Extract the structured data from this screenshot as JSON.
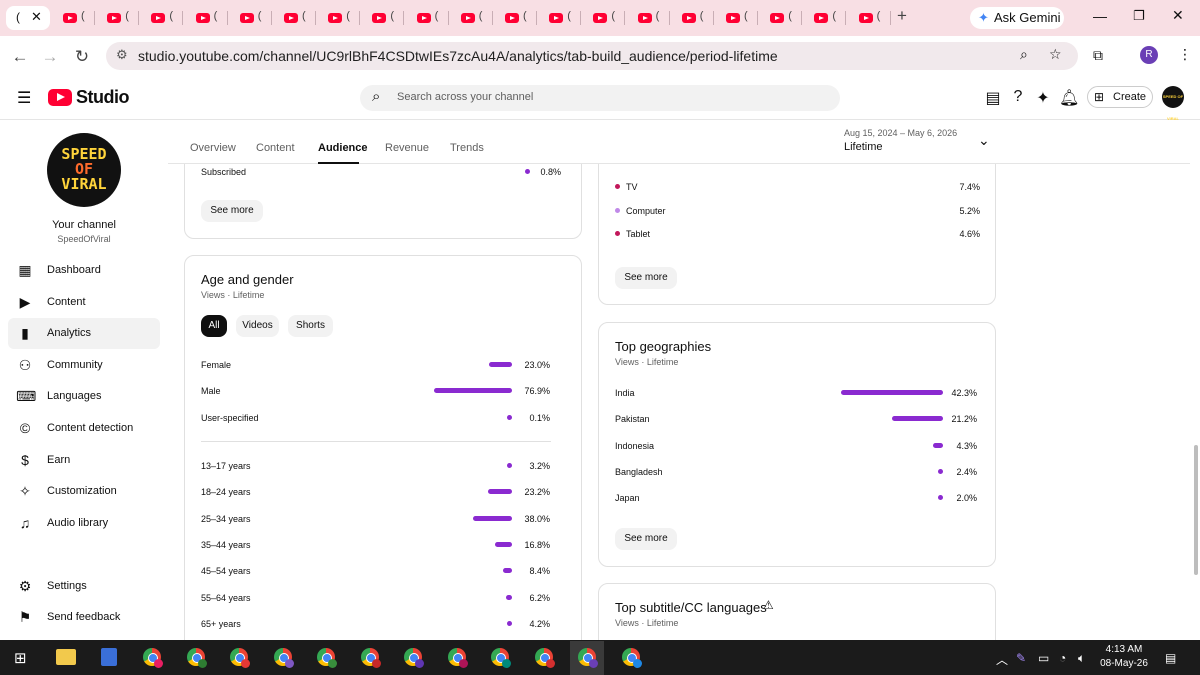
{
  "browser": {
    "ask_gemini": "Ask Gemini",
    "url": "studio.youtube.com/channel/UC9rlBhF4CSDtwIEs7zcAu4A/analytics/tab-build_audience/period-lifetime",
    "new_tab_glyph": "+",
    "profile_initial": "R"
  },
  "studio": {
    "logo_text": "Studio",
    "search_placeholder": "Search across your channel",
    "create_label": "Create",
    "avatar_text": "SPEED OF VIRAL"
  },
  "sidebar": {
    "avatar_lines": [
      "SPEED",
      "OF",
      "VIRAL"
    ],
    "your_channel": "Your channel",
    "handle": "SpeedOfViral",
    "items": [
      {
        "label": "Dashboard",
        "icon": "dashboard-icon"
      },
      {
        "label": "Content",
        "icon": "content-icon"
      },
      {
        "label": "Analytics",
        "icon": "analytics-icon",
        "active": true
      },
      {
        "label": "Community",
        "icon": "community-icon"
      },
      {
        "label": "Languages",
        "icon": "languages-icon"
      },
      {
        "label": "Content detection",
        "icon": "copyright-icon"
      },
      {
        "label": "Earn",
        "icon": "dollar-icon"
      },
      {
        "label": "Customization",
        "icon": "magic-wand-icon"
      },
      {
        "label": "Audio library",
        "icon": "audio-library-icon"
      }
    ],
    "settings": "Settings",
    "feedback": "Send feedback"
  },
  "analytics_tabs": {
    "items": [
      "Overview",
      "Content",
      "Audience",
      "Revenue",
      "Trends"
    ],
    "active": "Audience",
    "period_range": "Aug 15, 2024 – May 6, 2026",
    "period_value": "Lifetime"
  },
  "subscription_card": {
    "row_label": "Subscribed",
    "row_pct": "0.8%",
    "see_more": "See more"
  },
  "age_gender": {
    "title": "Age and gender",
    "subtitle": "Views · Lifetime",
    "filters": [
      "All",
      "Videos",
      "Shorts"
    ],
    "active_filter": "All",
    "gender": [
      {
        "label": "Female",
        "pct": "23.0%",
        "value": 23.0
      },
      {
        "label": "Male",
        "pct": "76.9%",
        "value": 76.9
      },
      {
        "label": "User-specified",
        "pct": "0.1%",
        "value": 0.1
      }
    ],
    "ages": [
      {
        "label": "13–17 years",
        "pct": "3.2%",
        "value": 3.2
      },
      {
        "label": "18–24 years",
        "pct": "23.2%",
        "value": 23.2
      },
      {
        "label": "25–34 years",
        "pct": "38.0%",
        "value": 38.0
      },
      {
        "label": "35–44 years",
        "pct": "16.8%",
        "value": 16.8
      },
      {
        "label": "45–54 years",
        "pct": "8.4%",
        "value": 8.4
      },
      {
        "label": "55–64 years",
        "pct": "6.2%",
        "value": 6.2
      },
      {
        "label": "65+ years",
        "pct": "4.2%",
        "value": 4.2
      }
    ]
  },
  "device_card": {
    "rows": [
      {
        "label": "TV",
        "pct": "7.4%"
      },
      {
        "label": "Computer",
        "pct": "5.2%"
      },
      {
        "label": "Tablet",
        "pct": "4.6%"
      }
    ],
    "see_more": "See more"
  },
  "geographies": {
    "title": "Top geographies",
    "subtitle": "Views · Lifetime",
    "rows": [
      {
        "label": "India",
        "pct": "42.3%",
        "value": 42.3
      },
      {
        "label": "Pakistan",
        "pct": "21.2%",
        "value": 21.2
      },
      {
        "label": "Indonesia",
        "pct": "4.3%",
        "value": 4.3
      },
      {
        "label": "Bangladesh",
        "pct": "2.4%",
        "value": 2.4
      },
      {
        "label": "Japan",
        "pct": "2.0%",
        "value": 2.0
      }
    ],
    "see_more": "See more"
  },
  "subtitles": {
    "title": "Top subtitle/CC languages",
    "subtitle": "Views · Lifetime",
    "warning_icon": "warning-icon"
  },
  "taskbar": {
    "time": "4:13 AM",
    "date": "08-May-26"
  },
  "colors": {
    "bar": "#8a2ad0",
    "tabstrip": "#f8dfe4",
    "yt_red": "#ff0033"
  }
}
